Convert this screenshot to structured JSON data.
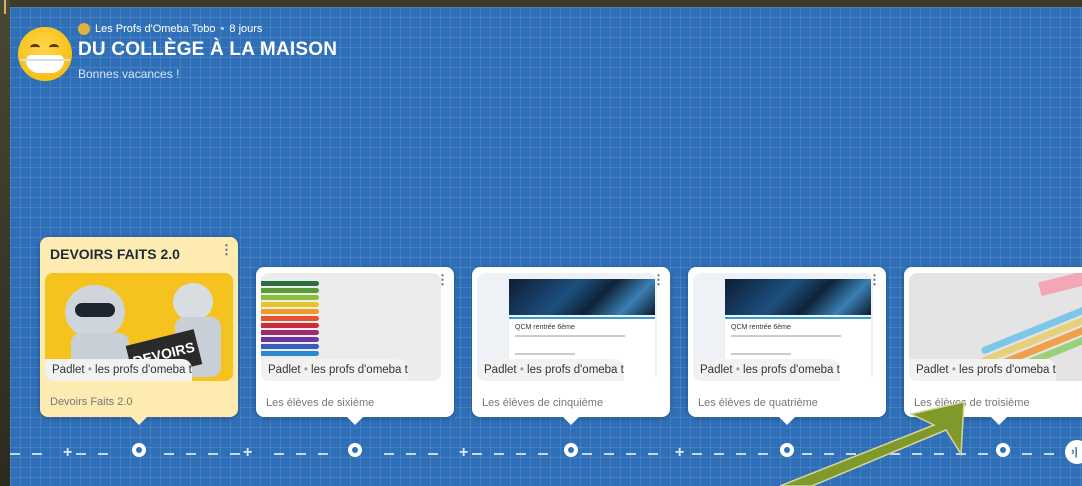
{
  "header": {
    "author": "Les Profs d'Omeba Tobo",
    "separator": "•",
    "age": "8 jours",
    "title": "DU COLLÈGE À LA MAISON",
    "subtitle": "Bonnes vacances !"
  },
  "cards": [
    {
      "title": "DEVOIRS FAITS 2.0",
      "thumb_text": "DEVOIRS",
      "source": "Padlet",
      "dot": "•",
      "owner": "les profs d'omeba tc",
      "caption": "Devoirs Faits 2.0"
    },
    {
      "source": "Padlet",
      "dot": "•",
      "owner": "les profs d'omeba tc",
      "caption": "Les élèves de sixième"
    },
    {
      "source": "Padlet",
      "dot": "•",
      "owner": "les profs d'omeba tc",
      "caption": "Les élèves de cinquième",
      "thumb_title": "QCM rentrée 6ème"
    },
    {
      "source": "Padlet",
      "dot": "•",
      "owner": "les profs d'omeba tc",
      "caption": "Les élèves de quatrième",
      "thumb_title": "QCM rentrée 6ème"
    },
    {
      "source": "Padlet",
      "dot": "•",
      "owner": "les profs d'omeba tc",
      "caption": "Les élèves de troisième"
    }
  ],
  "menu_glyph": "⋮",
  "timeline": {
    "plus_glyph": "+",
    "next_label": "›|"
  },
  "colors": {
    "board": "#2f6fb7",
    "highlight_card": "#fdebb2",
    "arrow": "#7f9a2a"
  }
}
